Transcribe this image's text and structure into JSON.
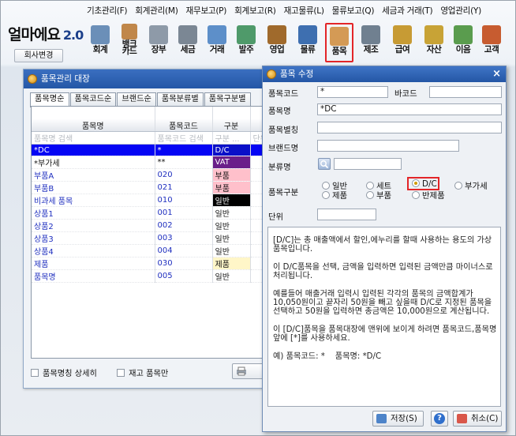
{
  "menu": [
    "기초관리(F)",
    "회계관리(M)",
    "재무보고(P)",
    "회계보고(R)",
    "재고물류(L)",
    "물류보고(Q)",
    "세금과 거래(T)",
    "영업관리(Y)"
  ],
  "logo": {
    "name": "얼마에요",
    "version": "2.0"
  },
  "company_button": "회사변경",
  "toolbar": [
    {
      "label": "회계",
      "icon": "calculator-icon",
      "color": "#6b8fb8"
    },
    {
      "label": "뱅크\n카드",
      "icon": "bank-icon",
      "color": "#c0874a"
    },
    {
      "label": "장부",
      "icon": "ledger-icon",
      "color": "#8e9aa8"
    },
    {
      "label": "세금",
      "icon": "tax-invoice-icon",
      "color": "#7b8794"
    },
    {
      "label": "거래",
      "icon": "trade-icon",
      "color": "#5d8fc9"
    },
    {
      "label": "발주",
      "icon": "order-icon",
      "color": "#4f9a6a"
    },
    {
      "label": "영업",
      "icon": "briefcase-icon",
      "color": "#a06a2c"
    },
    {
      "label": "물류",
      "icon": "truck-icon",
      "color": "#3e6fb0"
    },
    {
      "label": "품목",
      "icon": "box-icon",
      "color": "#d49a55",
      "selected": true
    },
    {
      "label": "제조",
      "icon": "tools-icon",
      "color": "#708090"
    },
    {
      "label": "급여",
      "icon": "money-bag-icon",
      "color": "#c79b34"
    },
    {
      "label": "자산",
      "icon": "asset-icon",
      "color": "#c8a336"
    },
    {
      "label": "이음",
      "icon": "link-money-icon",
      "color": "#5a9c4e"
    },
    {
      "label": "고객",
      "icon": "customer-icon",
      "color": "#c75c30"
    }
  ],
  "registry": {
    "title": "품목관리 대장",
    "tabs": [
      "품목명순",
      "품목코드순",
      "브랜드순",
      "품목분류별",
      "품목구분별"
    ],
    "columns": [
      "품목명",
      "품목코드",
      "구분",
      "단"
    ],
    "filter_placeholders": [
      "품목명 검색",
      "품목코드 검색",
      "구분 ...",
      "단위"
    ],
    "rows": [
      {
        "name": "*DC",
        "code": "*",
        "type": "D/C",
        "selected": true,
        "type_style": "sel"
      },
      {
        "name": "*부가세",
        "code": "**",
        "type": "VAT",
        "type_style": "purple"
      },
      {
        "name": "부품A",
        "code": "020",
        "type": "부품",
        "type_style": "pink",
        "blue": true
      },
      {
        "name": "부품B",
        "code": "021",
        "type": "부품",
        "type_style": "pink",
        "blue": true
      },
      {
        "name": "비과세 품목",
        "code": "010",
        "type": "일반",
        "type_style": "black",
        "blue": true
      },
      {
        "name": "상품1",
        "code": "001",
        "type": "일반",
        "blue": true
      },
      {
        "name": "상품2",
        "code": "002",
        "type": "일반",
        "blue": true
      },
      {
        "name": "상품3",
        "code": "003",
        "type": "일반",
        "blue": true
      },
      {
        "name": "상품4",
        "code": "004",
        "type": "일반",
        "blue": true
      },
      {
        "name": "제품",
        "code": "030",
        "type": "제품",
        "type_style": "yellow",
        "blue": true
      },
      {
        "name": "품목명",
        "code": "005",
        "type": "일반",
        "blue": true
      }
    ],
    "opt_detail": "품목명칭 상세히",
    "opt_stock_only": "재고 품목만"
  },
  "dialog": {
    "title": "품목 수정",
    "labels": {
      "code": "품목코드",
      "barcode": "바코드",
      "name": "품목명",
      "alias": "품목별칭",
      "brand": "브랜드명",
      "category": "분류명",
      "kind": "품목구분",
      "unit": "단위"
    },
    "values": {
      "code": "*",
      "barcode": "",
      "name": "*DC",
      "alias": "",
      "brand": "",
      "category": "",
      "unit": ""
    },
    "kinds": [
      "일반",
      "세트",
      "D/C",
      "부가세",
      "제품",
      "부품",
      "반제품"
    ],
    "selected_kind": "D/C",
    "description": [
      "[D/C]는 총 매출액에서 할인,에누리를 할때 사용하는 용도의 가상품목입니다.",
      "이 D/C품목을 선택, 금액을 입력하면 입력된 금액만큼 마이너스로 처리됩니다.",
      "예를들어 매출거래 입력시 입력된 각각의 품목의 금액합계가 10,050원이고 끝자리 50원을 빼고 싶을때 D/C로 지정된 품목을 선택하고 50원을 입력하면 총금액은 10,000원으로 계산됩니다.",
      "이 [D/C]품목을 품목대장에 맨위에 보이게 하려면 품목코드,품목명앞에 [*]를 사용하세요.",
      "예) 품목코드: *    품목명: *D/C"
    ],
    "buttons": {
      "save": "저장(S)",
      "cancel": "취소(C)"
    }
  }
}
